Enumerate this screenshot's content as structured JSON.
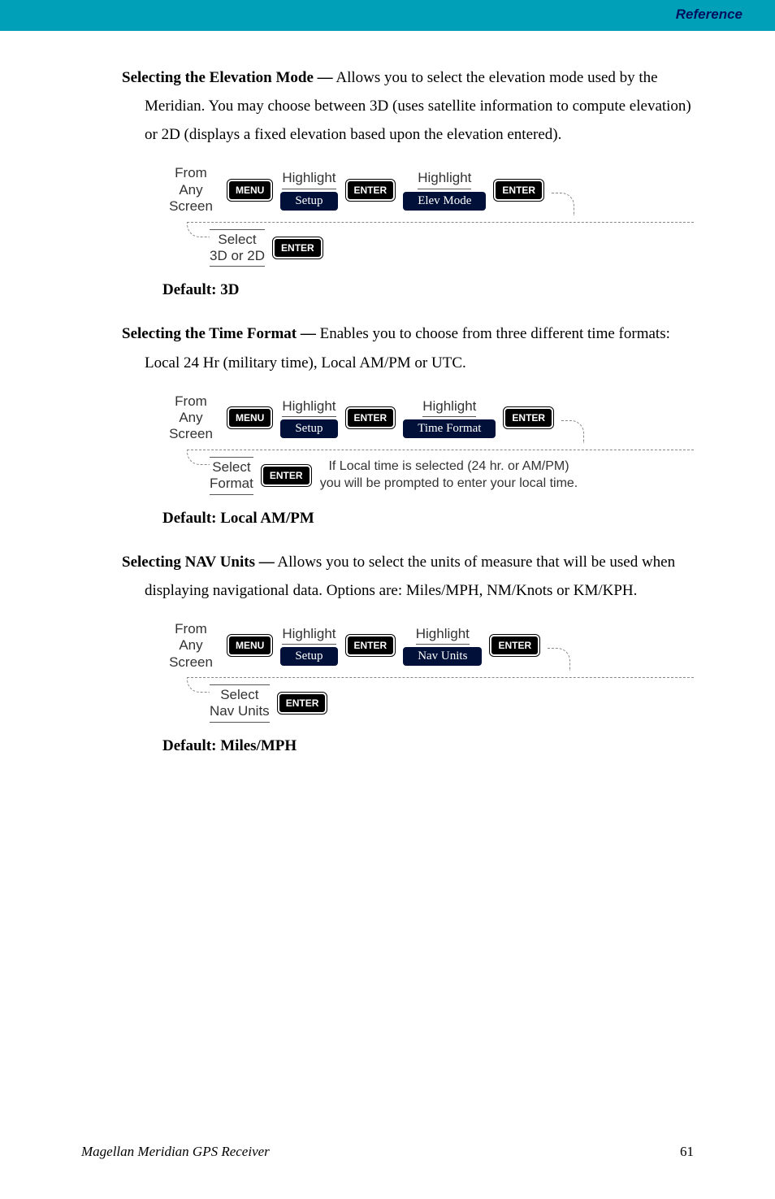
{
  "header": {
    "reference": "Reference"
  },
  "sections": [
    {
      "title": "Selecting the Elevation Mode —",
      "body": " Allows you to select the elevation mode used by the Meridian.  You may choose between 3D (uses satellite information to compute elevation) or 2D (displays a fixed elevation based upon the elevation entered).",
      "flow": {
        "from": "From\nAny\nScreen",
        "menu": "MENU",
        "hl1": "Highlight",
        "pill1": "Setup",
        "enter1": "ENTER",
        "hl2": "Highlight",
        "pill2": "Elev Mode",
        "enter2": "ENTER",
        "sel": "Select\n3D or 2D",
        "enter3": "ENTER",
        "note": ""
      },
      "default": "Default: 3D"
    },
    {
      "title": "Selecting the Time Format —",
      "body": " Enables you to choose from three different time formats: Local 24 Hr (military time), Local AM/PM or UTC.",
      "flow": {
        "from": "From\nAny\nScreen",
        "menu": "MENU",
        "hl1": "Highlight",
        "pill1": "Setup",
        "enter1": "ENTER",
        "hl2": "Highlight",
        "pill2": "Time Format",
        "enter2": "ENTER",
        "sel": "Select\nFormat",
        "enter3": "ENTER",
        "note": "If Local time is selected (24 hr. or AM/PM) you will be prompted to enter your local time."
      },
      "default": "Default:  Local AM/PM"
    },
    {
      "title": "Selecting NAV Units —",
      "body": "  Allows you to select the units of measure that will be used when displaying navigational data.  Options are:  Miles/MPH, NM/Knots or KM/KPH.",
      "flow": {
        "from": "From\nAny\nScreen",
        "menu": "MENU",
        "hl1": "Highlight",
        "pill1": "Setup",
        "enter1": "ENTER",
        "hl2": "Highlight",
        "pill2": "Nav Units",
        "enter2": "ENTER",
        "sel": "Select\nNav Units",
        "enter3": "ENTER",
        "note": ""
      },
      "default": "Default: Miles/MPH"
    }
  ],
  "footer": {
    "left": "Magellan Meridian GPS Receiver",
    "right": "61"
  }
}
